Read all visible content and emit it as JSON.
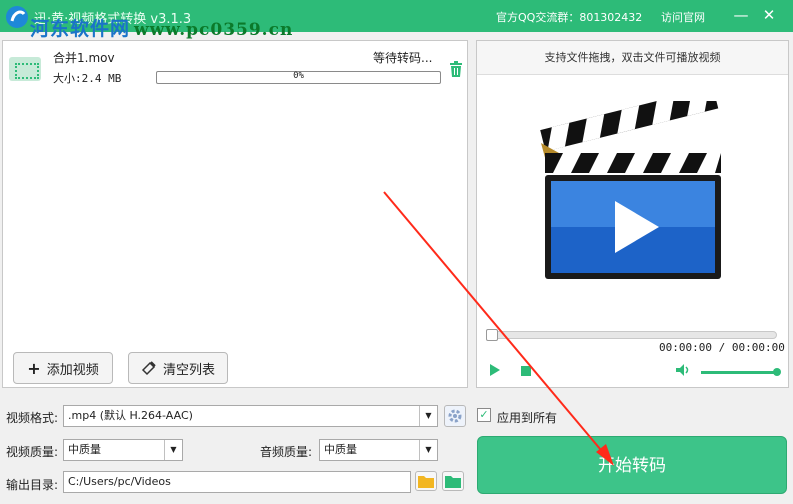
{
  "app": {
    "title": "迅·黄·视频格式转换 v3.1.3",
    "qq_group": "官方QQ交流群：801302432",
    "website_link": "访问官网",
    "minimize_icon": "minimize-icon",
    "close_icon": "close-icon"
  },
  "watermark": {
    "cn": "河东软件网",
    "url": "www.pc0359.cn"
  },
  "file_list": {
    "items": [
      {
        "name": "合并1.mov",
        "size_text": "大小:2.4 MB",
        "status": "等待转码...",
        "progress_text": "0%",
        "progress": 0
      }
    ],
    "add_video_label": "添加视频",
    "clear_list_label": "清空列表"
  },
  "preview": {
    "hint": "支持文件拖拽，双击文件可播放视频",
    "timecode": "00:00:00 / 00:00:00",
    "seek": 0,
    "volume": 1
  },
  "settings": {
    "format_label": "视频格式:",
    "format_value": ".mp4 (默认 H.264-AAC)",
    "video_quality_label": "视频质量:",
    "video_quality_value": "中质量",
    "audio_quality_label": "音频质量:",
    "audio_quality_value": "中质量",
    "output_label": "输出目录:",
    "output_path": "C:/Users/pc/Videos",
    "apply_all_label": "应用到所有",
    "apply_all_checked": true
  },
  "start_button": "开始转码",
  "colors": {
    "accent": "#2dbb78",
    "start_button": "#3dc489",
    "annotation_arrow": "#ff2a1a"
  }
}
